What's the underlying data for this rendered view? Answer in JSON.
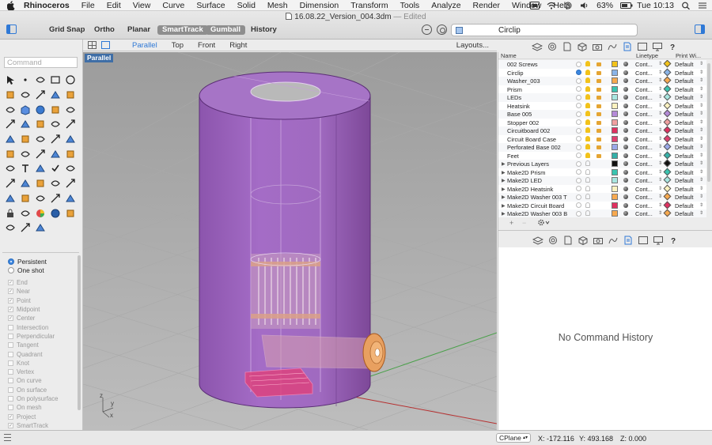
{
  "menubar": {
    "app_name": "Rhinoceros",
    "menus": [
      "File",
      "Edit",
      "View",
      "Curve",
      "Surface",
      "Solid",
      "Mesh",
      "Dimension",
      "Transform",
      "Tools",
      "Analyze",
      "Render",
      "Window",
      "Help"
    ],
    "battery": "63%",
    "clock": "Tue 10:13",
    "icons": [
      "apple-icon",
      "finder-icon",
      "wifi-icon",
      "sync-icon",
      "volume-icon",
      "battery-icon",
      "spotlight-icon",
      "list-icon"
    ]
  },
  "titlebar": {
    "document": "16.08.22_Version_004.3dm",
    "state": "— Edited",
    "buttons": {
      "grid_snap": "Grid Snap",
      "ortho": "Ortho",
      "planar": "Planar",
      "smarttrack": "SmartTrack",
      "gumball": "Gumball",
      "history": "History"
    },
    "current_layer": "Circlip"
  },
  "command": {
    "placeholder": "Command",
    "value": ""
  },
  "tools": [
    "select-arrow-icon",
    "point-icon",
    "polyline-icon",
    "rectangle-icon",
    "circle-icon",
    "ellipse-icon",
    "arc-icon",
    "rectangle-surface-icon",
    "extrude-icon",
    "revolve-icon",
    "loft-icon",
    "box-icon",
    "sphere-icon",
    "cylinder-icon",
    "pipe-icon",
    "fillet-icon",
    "boolean-union-icon",
    "boolean-difference-icon",
    "move-icon",
    "rotate-icon",
    "scale-icon",
    "mirror-icon",
    "array-icon",
    "copy-icon",
    "trim-icon",
    "split-icon",
    "join-icon",
    "explode-icon",
    "group-icon",
    "offset-icon",
    "dimension-icon",
    "text-icon",
    "hatch-icon",
    "check-icon",
    "analyze-icon",
    "points-on-icon",
    "curvature-icon",
    "zoom-icon",
    "pan-icon",
    "layer-icon",
    "render-icon",
    "car-icon",
    "material-icon",
    "light-icon",
    "camera-icon",
    "lock-icon",
    "eraser-icon",
    "color-wheel-icon",
    "globe-icon",
    "grid-icon",
    "shade-icon",
    "pointer-icon",
    "projection-icon"
  ],
  "snap_modes": [
    {
      "label": "Persistent",
      "selected": true
    },
    {
      "label": "One shot",
      "selected": false
    }
  ],
  "osnaps": [
    {
      "label": "End",
      "checked": true
    },
    {
      "label": "Near",
      "checked": true
    },
    {
      "label": "Point",
      "checked": true
    },
    {
      "label": "Midpoint",
      "checked": true
    },
    {
      "label": "Center",
      "checked": true
    },
    {
      "label": "Intersection",
      "checked": false
    },
    {
      "label": "Perpendicular",
      "checked": false
    },
    {
      "label": "Tangent",
      "checked": false
    },
    {
      "label": "Quadrant",
      "checked": false
    },
    {
      "label": "Knot",
      "checked": false
    },
    {
      "label": "Vertex",
      "checked": false
    },
    {
      "label": "On curve",
      "checked": false
    },
    {
      "label": "On surface",
      "checked": false
    },
    {
      "label": "On polysurface",
      "checked": false
    },
    {
      "label": "On mesh",
      "checked": false
    },
    {
      "label": "Project",
      "checked": true
    },
    {
      "label": "SmartTrack",
      "checked": true
    }
  ],
  "viewport": {
    "tabs": [
      "Parallel",
      "Top",
      "Front",
      "Right"
    ],
    "active_tab": "Parallel",
    "layouts_label": "Layouts...",
    "label": "Parallel",
    "axis_labels": {
      "z": "z",
      "x": "x",
      "y": "y"
    }
  },
  "layers": {
    "columns": {
      "name": "Name",
      "linetype": "Linetype",
      "print_width": "Print Wi..."
    },
    "rows": [
      {
        "name": "002 Screws",
        "color": "#f2c21a",
        "print_color": "#f2c21a",
        "current": false,
        "expander": false
      },
      {
        "name": "Circlip",
        "color": "#8ab4e8",
        "print_color": "#8ab4e8",
        "current": true,
        "expander": false
      },
      {
        "name": "Washer_003",
        "color": "#f7a94f",
        "print_color": "#f7a94f",
        "current": false,
        "expander": false
      },
      {
        "name": "Prism",
        "color": "#3ac4b0",
        "print_color": "#3ac4b0",
        "current": false,
        "expander": false
      },
      {
        "name": "LEDs",
        "color": "#a8e6e0",
        "print_color": "#a8e6e0",
        "current": false,
        "expander": false
      },
      {
        "name": "Heatsink",
        "color": "#fcf2c0",
        "print_color": "#fcf2c0",
        "current": false,
        "expander": false
      },
      {
        "name": "Base 005",
        "color": "#b48ad8",
        "print_color": "#b48ad8",
        "current": false,
        "expander": false
      },
      {
        "name": "Stopper 002",
        "color": "#f0a0a0",
        "print_color": "#f0a0a0",
        "current": false,
        "expander": false
      },
      {
        "name": "Circuitboard 002",
        "color": "#e03060",
        "print_color": "#e03060",
        "current": false,
        "expander": false
      },
      {
        "name": "Circuit Board Case",
        "color": "#e04070",
        "print_color": "#e04070",
        "current": false,
        "expander": false
      },
      {
        "name": "Perforated Base 002",
        "color": "#9aa8e8",
        "print_color": "#9aa8e8",
        "current": false,
        "expander": false
      },
      {
        "name": "Feet",
        "color": "#34b0a8",
        "print_color": "#34b0a8",
        "current": false,
        "expander": false
      },
      {
        "name": "Previous Layers",
        "color": "#111111",
        "print_color": "#111111",
        "current": false,
        "expander": true
      },
      {
        "name": "Make2D Prism",
        "color": "#3ac4b0",
        "print_color": "#3ac4b0",
        "current": false,
        "expander": true
      },
      {
        "name": "Make2D LED",
        "color": "#a8e6e0",
        "print_color": "#a8e6e0",
        "current": false,
        "expander": true
      },
      {
        "name": "Make2D Heatsink",
        "color": "#fcf2c0",
        "print_color": "#fcf2c0",
        "current": false,
        "expander": true
      },
      {
        "name": "Make2D Washer 003 T",
        "color": "#f7a94f",
        "print_color": "#f7a94f",
        "current": false,
        "expander": true
      },
      {
        "name": "Make2D Circuit Board",
        "color": "#e03060",
        "print_color": "#e03060",
        "current": false,
        "expander": true
      },
      {
        "name": "Make2D Washer 003 B",
        "color": "#f7a94f",
        "print_color": "#f7a94f",
        "current": false,
        "expander": true
      }
    ],
    "linetype_value": "Cont...",
    "print_width_value": "Default"
  },
  "panel_tabs": [
    "layers-icon",
    "display-icon",
    "document-icon",
    "object-icon",
    "camera-icon",
    "rendering-icon",
    "properties-icon",
    "viewport-icon",
    "monitor-icon",
    "help-icon"
  ],
  "history": {
    "empty_text": "No Command History"
  },
  "status": {
    "cplane": "CPlane",
    "x": "X: -172.116",
    "y": "Y: 493.168",
    "z": "Z: 0.000"
  }
}
